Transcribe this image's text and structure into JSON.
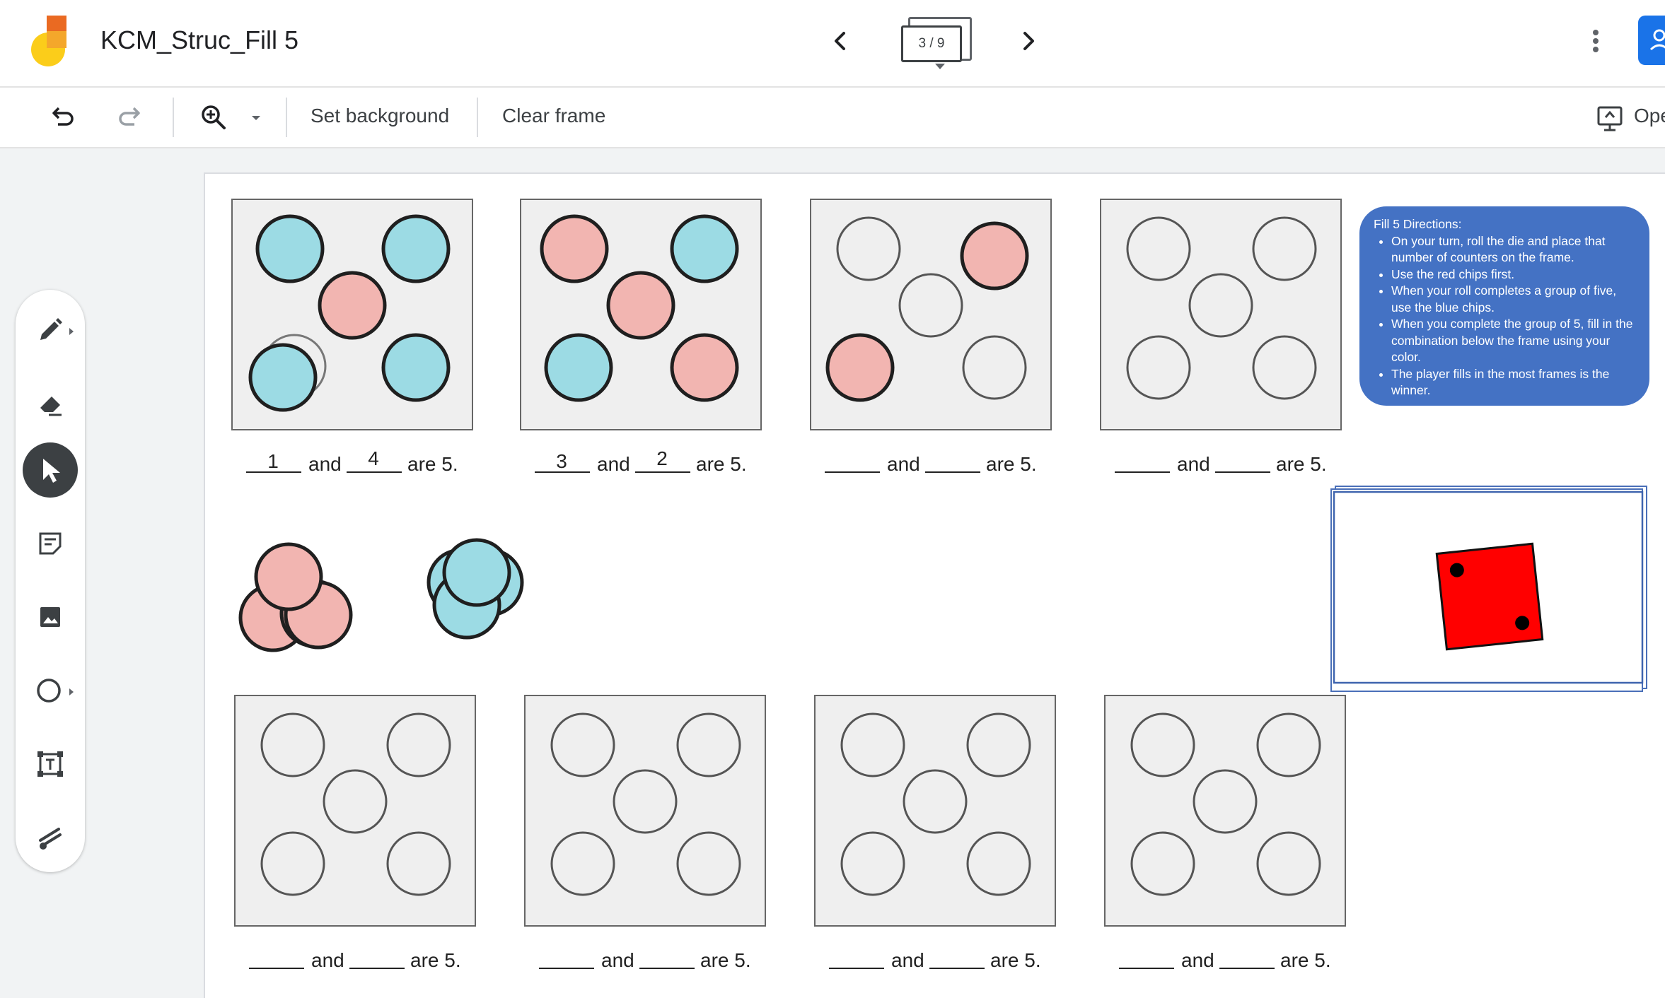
{
  "app": {
    "title": "KCM_Struc_Fill 5",
    "frame_counter": "3 / 9"
  },
  "toolbar": {
    "set_background_label": "Set background",
    "clear_frame_label": "Clear frame",
    "open_label": "Open"
  },
  "tools": [
    {
      "name": "pen-tool",
      "icon": "pen-icon",
      "active": false
    },
    {
      "name": "eraser-tool",
      "icon": "eraser-icon",
      "active": false
    },
    {
      "name": "select-tool",
      "icon": "cursor-arrow-icon",
      "active": true
    },
    {
      "name": "sticky-note-tool",
      "icon": "sticky-note-icon",
      "active": false
    },
    {
      "name": "image-tool",
      "icon": "image-icon",
      "active": false
    },
    {
      "name": "shape-tool",
      "icon": "circle-icon",
      "active": false
    },
    {
      "name": "text-box-tool",
      "icon": "text-box-icon",
      "active": false
    },
    {
      "name": "laser-tool",
      "icon": "laser-icon",
      "active": false
    }
  ],
  "colors": {
    "red_chip": "#f2b5b1",
    "blue_chip": "#9cdbe4",
    "frame_bg": "#efefef",
    "directions_bg": "#4472c4",
    "die": "#ff0000",
    "handwriting_orange": "#f3b63e",
    "handwriting_green": "#79b44c",
    "accent": "#1a73e8"
  },
  "frames": [
    {
      "chips": [
        "blue",
        "blue",
        "red",
        "blue",
        "blue"
      ],
      "extra_chip": true,
      "first": "1",
      "second": "4",
      "ink": "orange",
      "and": "and",
      "are": "are 5."
    },
    {
      "chips": [
        "red",
        "blue",
        "red",
        "blue",
        "red"
      ],
      "first": "3",
      "second": "2",
      "ink": "green",
      "and": "and",
      "are": "are 5."
    },
    {
      "chips": [
        "empty",
        "red",
        "empty",
        "red",
        "empty"
      ],
      "first": "",
      "second": "",
      "and": "and",
      "are": "are 5."
    },
    {
      "chips": [
        "empty",
        "empty",
        "empty",
        "empty",
        "empty"
      ],
      "first": "",
      "second": "",
      "and": "and",
      "are": "are 5."
    },
    {
      "chips": [
        "empty",
        "empty",
        "empty",
        "empty",
        "empty"
      ],
      "first": "",
      "second": "",
      "and": "and",
      "are": "are 5."
    },
    {
      "chips": [
        "empty",
        "empty",
        "empty",
        "empty",
        "empty"
      ],
      "first": "",
      "second": "",
      "and": "and",
      "are": "are 5."
    },
    {
      "chips": [
        "empty",
        "empty",
        "empty",
        "empty",
        "empty"
      ],
      "first": "",
      "second": "",
      "and": "and",
      "are": "are 5."
    },
    {
      "chips": [
        "empty",
        "empty",
        "empty",
        "empty",
        "empty"
      ],
      "first": "",
      "second": "",
      "and": "and",
      "are": "are 5."
    }
  ],
  "chip_piles": {
    "red_count": 4,
    "blue_count": 4
  },
  "directions": {
    "heading": "Fill 5 Directions:",
    "items": [
      "On your turn, roll the die and place that number of counters on the frame.",
      "Use the red chips first.",
      "When your roll completes a group of five, use the blue chips.",
      "When you complete the group of 5,  fill in the combination below the frame using your color.",
      "The player fills in the most frames is the winner."
    ]
  },
  "die": {
    "value": 2
  }
}
